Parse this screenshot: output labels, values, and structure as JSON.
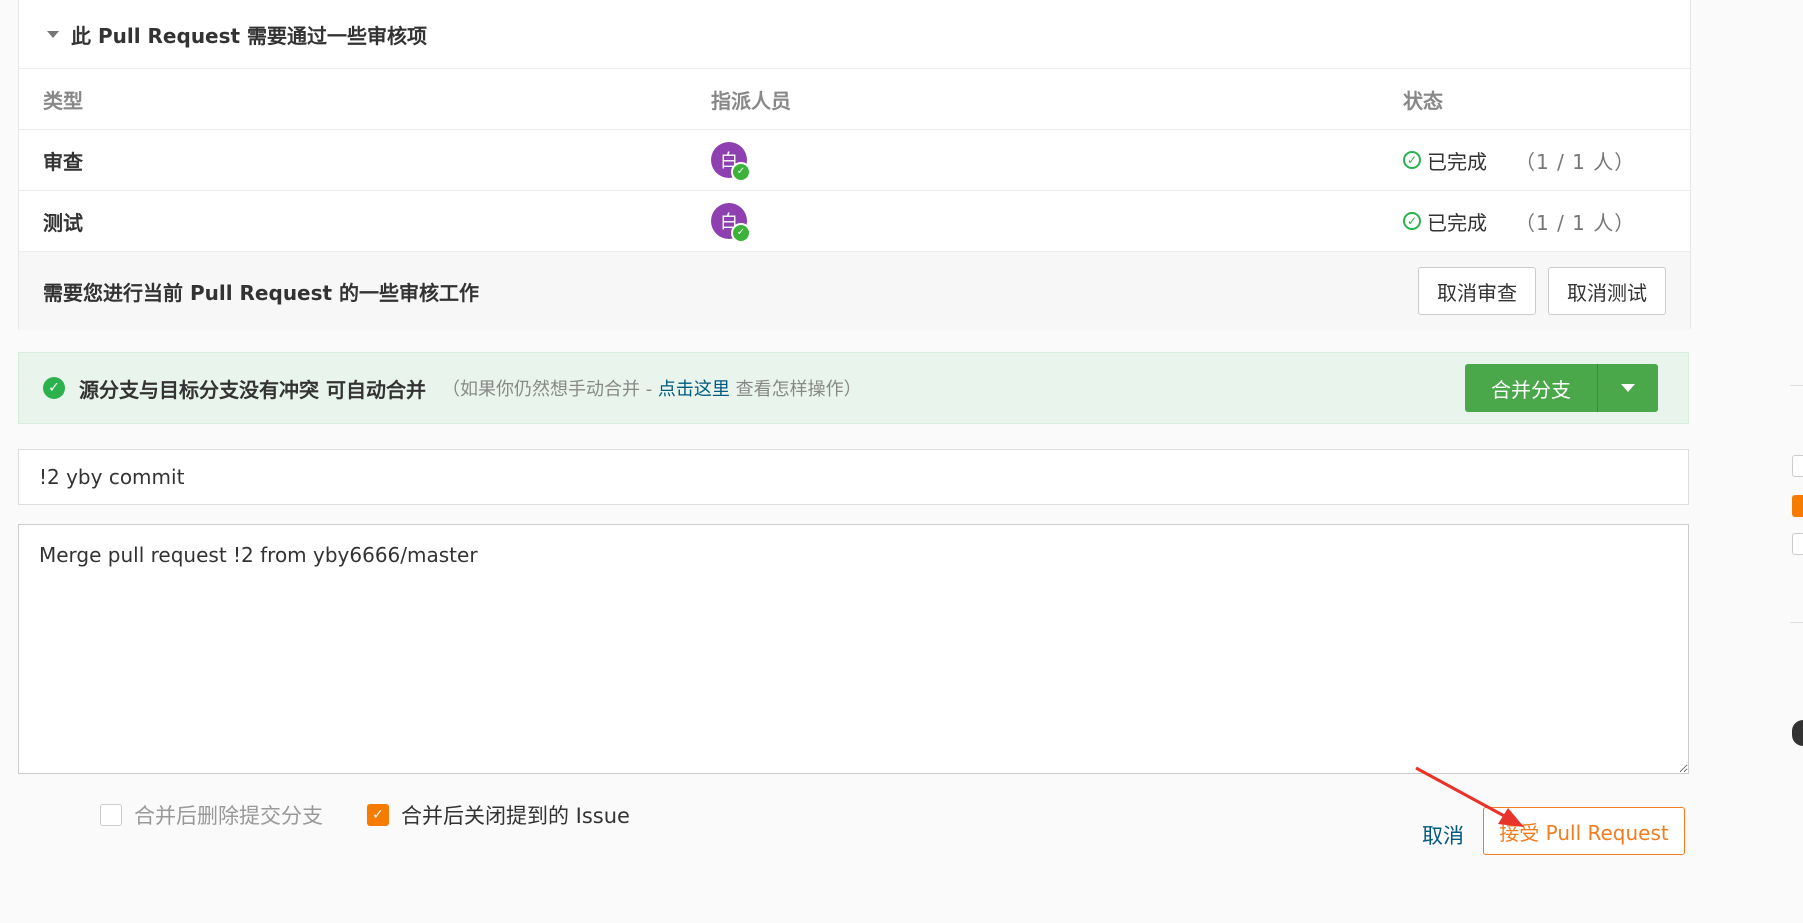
{
  "review": {
    "header": "此 Pull Request 需要通过一些审核项",
    "columns": {
      "type": "类型",
      "assignee": "指派人员",
      "status": "状态"
    },
    "rows": [
      {
        "type": "审查",
        "avatar_text": "白",
        "status": "已完成",
        "count": "（1 / 1 人）"
      },
      {
        "type": "测试",
        "avatar_text": "白",
        "status": "已完成",
        "count": "（1 / 1 人）"
      }
    ],
    "footer_text": "需要您进行当前 Pull Request 的一些审核工作",
    "cancel_review": "取消审查",
    "cancel_test": "取消测试"
  },
  "merge": {
    "title": "源分支与目标分支没有冲突 可自动合并",
    "hint_prefix": "（如果你仍然想手动合并 - ",
    "hint_link": "点击这里",
    "hint_suffix": " 查看怎样操作）",
    "button": "合并分支"
  },
  "commit": {
    "title_value": "!2 yby commit",
    "message_value": "Merge pull request !2 from yby6666/master"
  },
  "options": {
    "delete_branch": "合并后删除提交分支",
    "close_issue": "合并后关闭提到的 Issue"
  },
  "actions": {
    "cancel": "取消",
    "accept": "接受 Pull Request"
  },
  "colors": {
    "accent_orange": "#f27c1e",
    "merge_green": "#4aa74a",
    "link_blue": "#005980",
    "avatar_purple": "#8e3fb0",
    "annotation_red": "#e8332a"
  }
}
